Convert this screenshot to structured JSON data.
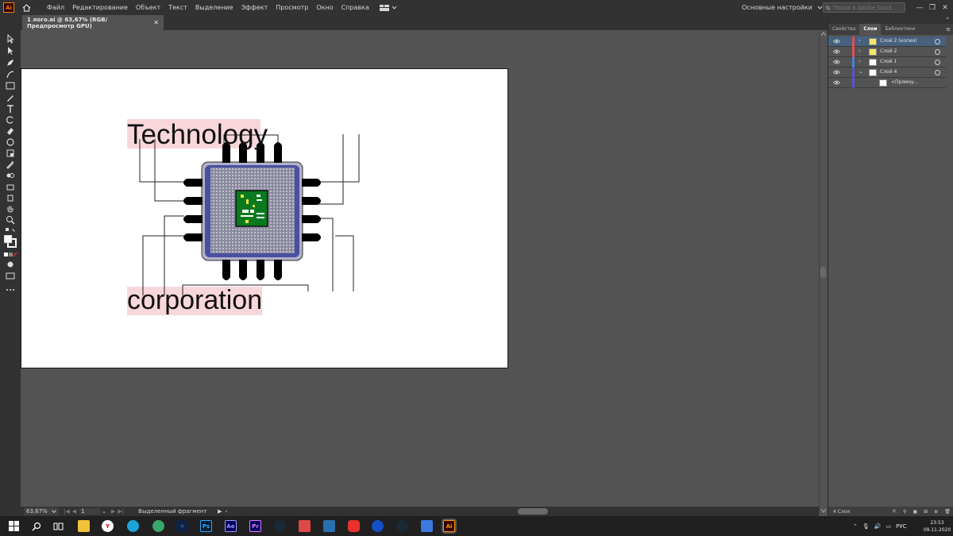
{
  "app": {
    "logo": "Ai",
    "window_title": "1 лого.ai @ 63,67% (RGB/Предпросмотр GPU)"
  },
  "menu": [
    "Файл",
    "Редактирование",
    "Объект",
    "Текст",
    "Выделение",
    "Эффект",
    "Просмотр",
    "Окно",
    "Справка"
  ],
  "workspace": "Основные настройки",
  "stock_search": {
    "placeholder": "Поиск в Adobe Stock"
  },
  "tabs": {
    "close": "✕"
  },
  "artboard": {
    "title_text": "Technology",
    "subtitle_text": "corporation",
    "highlight_color": "#f8d7da",
    "chip_body_color": "#4a4fa0",
    "chip_core_color": "#0a7a1e"
  },
  "status": {
    "zoom": "63,67%",
    "artboard_num": "1",
    "tool_label": "Выделенный фрагмент"
  },
  "panel": {
    "tabs": [
      "Свойства",
      "Слои",
      "Библиотеки"
    ],
    "active_tab": "Слои",
    "layers": [
      {
        "name": "Слой 2 (копия)",
        "color": "#e05050",
        "arrow": "›",
        "selected": true
      },
      {
        "name": "Слой 2",
        "color": "#e05050",
        "arrow": "›",
        "selected": false
      },
      {
        "name": "Слой 1",
        "color": "#4c7fd8",
        "arrow": "›",
        "selected": false
      },
      {
        "name": "Слой 4",
        "color": "#5a4fd0",
        "arrow": "⌄",
        "selected": false
      },
      {
        "name": "<Прямоу...",
        "color": "#5a4fd0",
        "arrow": "",
        "selected": false
      }
    ],
    "footer_count": "4 Слоя"
  },
  "taskbar": {
    "icons": [
      "Ps",
      "Ae",
      "Pr",
      "Ai"
    ],
    "lang": "РУС",
    "time": "23:53",
    "date": "09.11.2020"
  }
}
